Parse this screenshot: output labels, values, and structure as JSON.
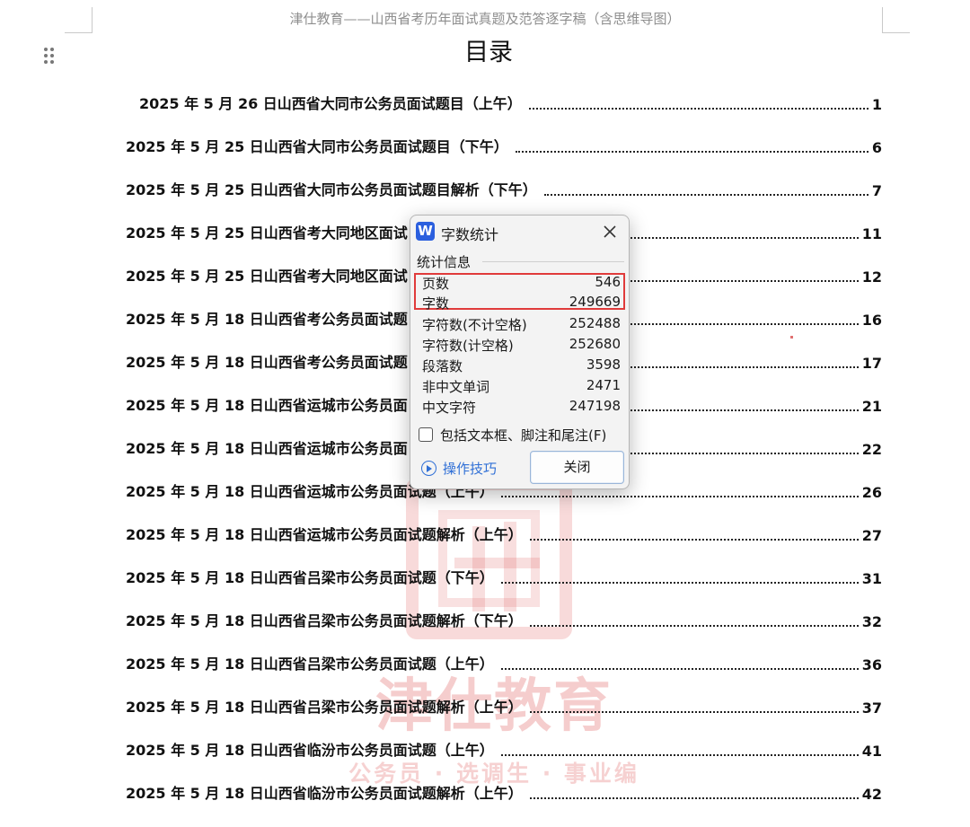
{
  "document": {
    "header": "津仕教育——山西省考历年面试真题及范答逐字稿（含思维导图）",
    "toc_title": "目录",
    "toc": [
      {
        "title": "2025 年 5 月 26 日山西省大同市公务员面试题目（上午）",
        "page": "1"
      },
      {
        "title": "2025 年 5 月 25 日山西省大同市公务员面试题目（下午）",
        "page": "6"
      },
      {
        "title": "2025 年 5 月 25 日山西省大同市公务员面试题目解析（下午）",
        "page": "7"
      },
      {
        "title": "2025 年 5 月 25 日山西省考大同地区面试",
        "page": "11"
      },
      {
        "title": "2025 年 5 月 25 日山西省考大同地区面试",
        "page": "12"
      },
      {
        "title": "2025 年 5 月 18 日山西省考公务员面试题",
        "page": "16"
      },
      {
        "title": "2025 年 5 月 18 日山西省考公务员面试题",
        "page": "17"
      },
      {
        "title": "2025 年 5 月 18 日山西省运城市公务员面",
        "page": "21"
      },
      {
        "title": "2025 年 5 月 18 日山西省运城市公务员面",
        "page": "22"
      },
      {
        "title": "2025 年 5 月 18 日山西省运城市公务员面试题（上午）",
        "page": "26"
      },
      {
        "title": "2025 年 5 月 18 日山西省运城市公务员面试题解析（上午）",
        "page": "27"
      },
      {
        "title": "2025 年 5 月 18 日山西省吕梁市公务员面试题（下午）",
        "page": "31"
      },
      {
        "title": "2025 年 5 月 18 日山西省吕梁市公务员面试题解析（下午）",
        "page": "32"
      },
      {
        "title": "2025 年 5 月 18 日山西省吕梁市公务员面试题（上午）",
        "page": "36"
      },
      {
        "title": "2025 年 5 月 18 日山西省吕梁市公务员面试题解析（上午）",
        "page": "37"
      },
      {
        "title": "2025 年 5 月 18 日山西省临汾市公务员面试题（上午）",
        "page": "41"
      },
      {
        "title": "2025 年 5 月 18 日山西省临汾市公务员面试题解析（上午）",
        "page": "42"
      }
    ],
    "watermark": {
      "brand": "津仕教育",
      "tagline": "公务员 · 选调生 · 事业编"
    }
  },
  "dialog": {
    "app_icon": "W",
    "title": "字数统计",
    "section_label": "统计信息",
    "stats": [
      {
        "label": "页数",
        "value": "546"
      },
      {
        "label": "字数",
        "value": "249669"
      },
      {
        "label": "字符数(不计空格)",
        "value": "252488"
      },
      {
        "label": "字符数(计空格)",
        "value": "252680"
      },
      {
        "label": "段落数",
        "value": "3598"
      },
      {
        "label": "非中文单词",
        "value": "2471"
      },
      {
        "label": "中文字符",
        "value": "247198"
      }
    ],
    "checkbox_label": "包括文本框、脚注和尾注(F)",
    "checkbox_checked": false,
    "tips_link": "操作技巧",
    "close_button": "关闭",
    "highlight_color": "#e03b3b"
  },
  "icons": {
    "app": "wps-writer-icon",
    "close": "close-icon",
    "tips": "play-circle-icon",
    "drag": "drag-handle-icon"
  }
}
